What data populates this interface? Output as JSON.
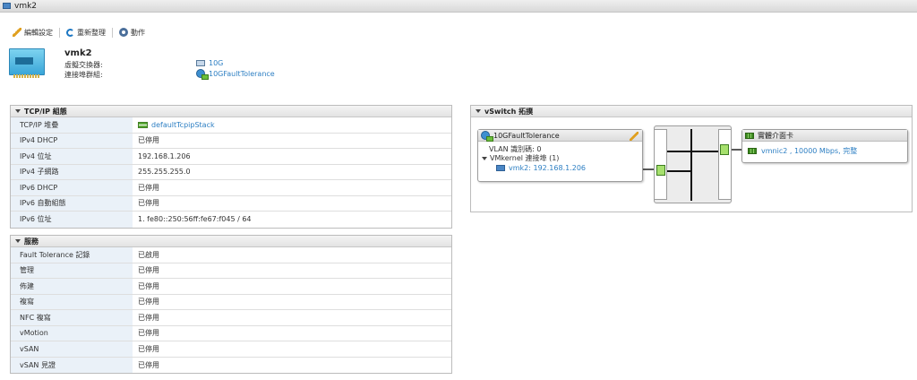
{
  "window": {
    "title": "vmk2"
  },
  "toolbar": {
    "edit_label": "編輯設定",
    "refresh_label": "重新整理",
    "actions_label": "動作"
  },
  "header": {
    "name": "vmk2",
    "vswitch_label": "虛擬交換器:",
    "vswitch_value": "10G",
    "portgroup_label": "連接埠群組:",
    "portgroup_value": "10GFaultTolerance"
  },
  "tcpip": {
    "title": "TCP/IP 組態",
    "rows": [
      {
        "key": "TCP/IP 堆疊",
        "value": "defaultTcpipStack"
      },
      {
        "key": "IPv4 DHCP",
        "value": "已停用"
      },
      {
        "key": "IPv4 位址",
        "value": "192.168.1.206"
      },
      {
        "key": "IPv4 子網路",
        "value": "255.255.255.0"
      },
      {
        "key": "IPv6 DHCP",
        "value": "已停用"
      },
      {
        "key": "IPv6 自動組態",
        "value": "已停用"
      },
      {
        "key": "IPv6 位址",
        "value": "1. fe80::250:56ff:fe67:f045 / 64"
      }
    ]
  },
  "services": {
    "title": "服務",
    "rows": [
      {
        "key": "Fault Tolerance 記錄",
        "value": "已啟用"
      },
      {
        "key": "管理",
        "value": "已停用"
      },
      {
        "key": "佈建",
        "value": "已停用"
      },
      {
        "key": "複寫",
        "value": "已停用"
      },
      {
        "key": "NFC 複寫",
        "value": "已停用"
      },
      {
        "key": "vMotion",
        "value": "已停用"
      },
      {
        "key": "vSAN",
        "value": "已停用"
      },
      {
        "key": "vSAN 見證",
        "value": "已停用"
      }
    ]
  },
  "topology": {
    "title": "vSwitch 拓撲",
    "portgroup_name": "10GFaultTolerance",
    "vlan": "VLAN 識別碼: 0",
    "vmkernel_ports": "VMkernel 連接埠 (1)",
    "vmk_entry": "vmk2: 192.168.1.206",
    "nic_title": "實體介面卡",
    "nic_entry": "vmnic2 , 10000 Mbps, 完整"
  },
  "colors": {
    "link": "#2d7fc3",
    "key_bg": "#eaf1f8",
    "port": "#a6e06d"
  }
}
